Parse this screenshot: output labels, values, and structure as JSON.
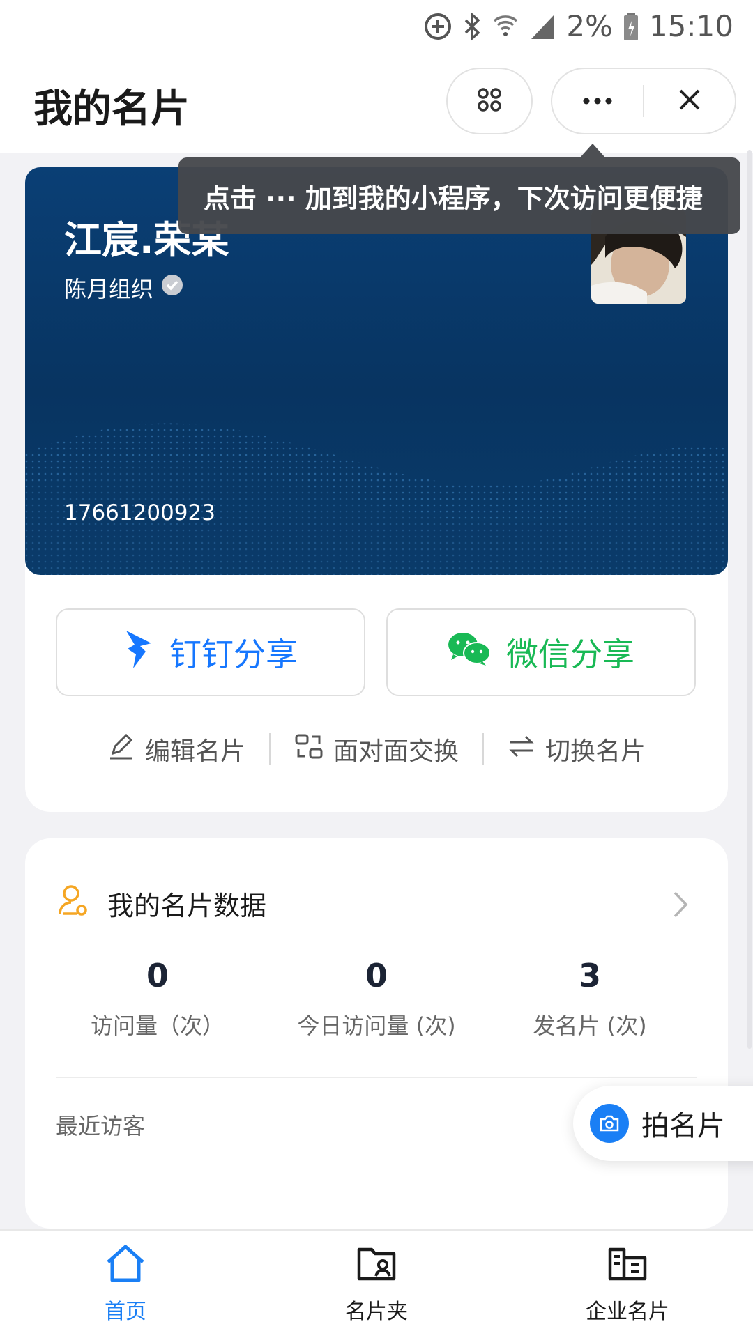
{
  "status_bar": {
    "battery": "2%",
    "time": "15:10",
    "icons": [
      "data-saver-icon",
      "bluetooth-icon",
      "wifi-icon",
      "signal-icon",
      "battery-icon"
    ]
  },
  "header": {
    "title": "我的名片",
    "apps_icon": "apps-icon",
    "more_icon": "more-icon",
    "close_icon": "close-icon"
  },
  "tooltip": {
    "text": "点击 ··· 加到我的小程序，下次访问更便捷"
  },
  "card": {
    "name": "江宸.荣某",
    "organization": "陈月组织",
    "verified_icon": "verified-badge-icon",
    "phone": "17661200923"
  },
  "share": {
    "dingtalk_label": "钉钉分享",
    "wechat_label": "微信分享"
  },
  "actions": {
    "edit_label": "编辑名片",
    "exchange_label": "面对面交换",
    "switch_label": "切换名片"
  },
  "stats": {
    "title": "我的名片数据",
    "items": [
      {
        "value": "0",
        "label": "访问量（次）"
      },
      {
        "value": "0",
        "label": "今日访问量 (次)"
      },
      {
        "value": "3",
        "label": "发名片 (次)"
      }
    ],
    "recent_label": "最近访客"
  },
  "scan_button": {
    "label": "拍名片"
  },
  "bottom_nav": {
    "items": [
      {
        "label": "首页",
        "icon": "home-icon",
        "active": true
      },
      {
        "label": "名片夹",
        "icon": "card-folder-icon",
        "active": false
      },
      {
        "label": "企业名片",
        "icon": "enterprise-card-icon",
        "active": false
      }
    ]
  },
  "colors": {
    "accent": "#1a7ff5",
    "dingtalk": "#1677ff",
    "wechat": "#19b955",
    "card_bg": "#083461",
    "stats_icon": "#f5a623"
  }
}
